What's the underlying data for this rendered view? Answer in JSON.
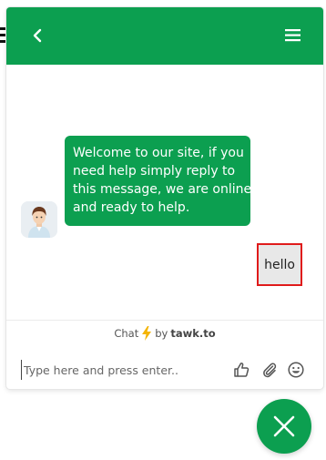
{
  "colors": {
    "brand_green": "#0c9f50",
    "highlight_red": "#e01b1b",
    "user_bubble_bg": "#e8e8e8"
  },
  "header": {
    "back_icon": "chevron-left-icon",
    "menu_icon": "hamburger-menu-icon"
  },
  "messages": {
    "agent": {
      "lines": [
        "Welcome to our site, if you",
        "need help simply reply to",
        "this message, we are online",
        "and ready to help."
      ],
      "avatar_icon": "agent-avatar-icon"
    },
    "user": {
      "text": "hello"
    }
  },
  "branding": {
    "prefix": "Chat",
    "by": "by",
    "brand": "tawk.to",
    "icon": "lightning-bolt-icon"
  },
  "composer": {
    "placeholder": "Type here and press enter..",
    "value": "",
    "tools": [
      "thumbs-up-icon",
      "paperclip-icon",
      "emoji-icon"
    ]
  },
  "fab": {
    "icon": "close-icon"
  }
}
